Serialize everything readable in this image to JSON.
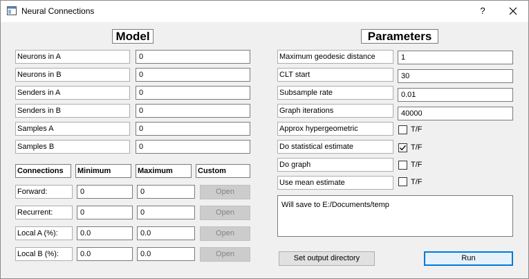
{
  "window": {
    "title": "Neural Connections",
    "help": "?",
    "close": "✕"
  },
  "model": {
    "heading": "Model",
    "rows": [
      {
        "label": "Neurons in A",
        "value": "0"
      },
      {
        "label": "Neurons in B",
        "value": "0"
      },
      {
        "label": "Senders in A",
        "value": "0"
      },
      {
        "label": "Senders in B",
        "value": "0"
      },
      {
        "label": "Samples A",
        "value": "0"
      },
      {
        "label": "Samples B",
        "value": "0"
      }
    ]
  },
  "connections": {
    "headers": {
      "connections": "Connections",
      "minimum": "Minimum",
      "maximum": "Maximum",
      "custom": "Custom"
    },
    "rows": [
      {
        "label": "Forward:",
        "min": "0",
        "max": "0",
        "button": "Open"
      },
      {
        "label": "Recurrent:",
        "min": "0",
        "max": "0",
        "button": "Open"
      },
      {
        "label": "Local A (%):",
        "min": "0.0",
        "max": "0.0",
        "button": "Open"
      },
      {
        "label": "Local B (%):",
        "min": "0.0",
        "max": "0.0",
        "button": "Open"
      }
    ]
  },
  "parameters": {
    "heading": "Parameters",
    "fields": [
      {
        "label": "Maximum geodesic distance",
        "value": "1"
      },
      {
        "label": "CLT start",
        "value": "30"
      },
      {
        "label": "Subsample rate",
        "value": "0.01"
      },
      {
        "label": "Graph iterations",
        "value": "40000"
      }
    ],
    "checks": [
      {
        "label": "Approx hypergeometric",
        "text": "T/F",
        "checked": false
      },
      {
        "label": "Do statistical estimate",
        "text": "T/F",
        "checked": true
      },
      {
        "label": "Do graph",
        "text": "T/F",
        "checked": false
      },
      {
        "label": "Use mean estimate",
        "text": "T/F",
        "checked": false
      }
    ],
    "output_text": "Will save to E:/Documents/temp",
    "set_output_button": "Set output directory",
    "run_button": "Run"
  }
}
